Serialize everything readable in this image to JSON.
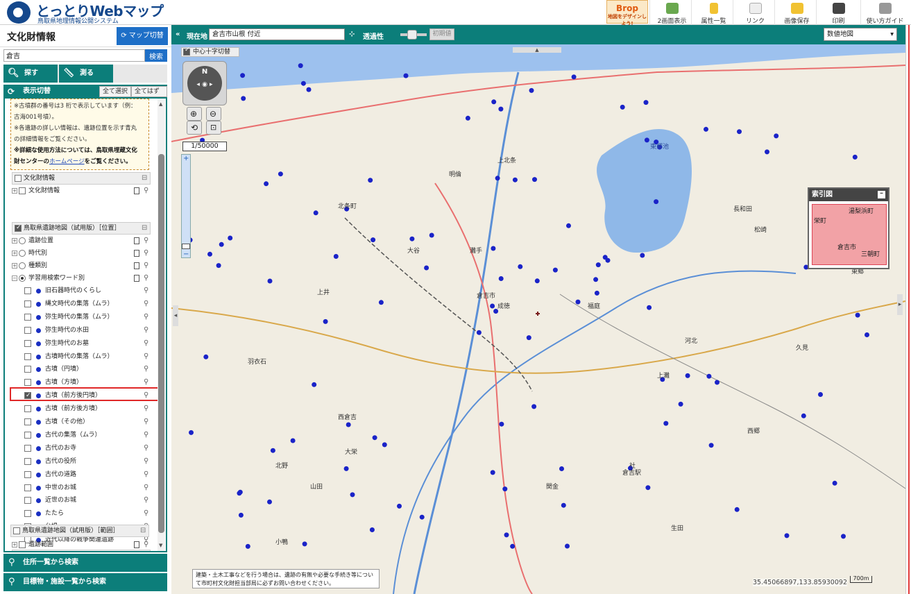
{
  "header": {
    "title": "とっとりWebマップ",
    "subtitle": "鳥取県地理情報公開システム",
    "ad_text": "地図をデザインしよう!",
    "ad_brand": "Brop",
    "toolbar": [
      {
        "label": "2画面表示",
        "icon": "split-screen-icon",
        "color": "#6aa84f"
      },
      {
        "label": "属性一覧",
        "icon": "attribute-list-icon",
        "color": "#f1c232"
      },
      {
        "label": "リンク",
        "icon": "mail-link-icon",
        "color": "#bbbbbb"
      },
      {
        "label": "画像保存",
        "icon": "image-save-icon",
        "color": "#f1c232"
      },
      {
        "label": "印刷",
        "icon": "print-icon",
        "color": "#444444"
      },
      {
        "label": "使い方ガイド",
        "icon": "guide-icon",
        "color": "#888888"
      }
    ]
  },
  "left_panel": {
    "title": "文化財情報",
    "map_switch": "マップ切替",
    "search_value": "倉吉",
    "search_button": "検索",
    "tabs": [
      {
        "label": "探す",
        "icon": "search-icon"
      },
      {
        "label": "測る",
        "icon": "ruler-icon"
      }
    ],
    "display_header": "表示切替",
    "select_all": "全て選択",
    "deselect_all": "全てはずす",
    "note_lines": [
      "※古墳群の番号は3 桁で表示しています（例：",
      "古海001号墳）。",
      "※各遺跡の詳しい情報は、遺跡位置を示す青丸",
      "の詳細情報をご覧ください。"
    ],
    "note_bold_1": "※詳細な使用方法については、鳥取県埋蔵文化",
    "note_bold_2_pre": "財センターの",
    "note_link": "ホームページ",
    "note_bold_2_post": "をご覧ください。",
    "groups": [
      {
        "label": "文化財情報",
        "checked": false
      },
      {
        "label": "鳥取県遺跡地図（試用版）［位置］",
        "checked": true
      },
      {
        "label": "鳥取県遺跡地図（試用版）［範囲］",
        "checked": false
      }
    ],
    "layers_top": [
      {
        "label": "文化財情報",
        "type": "checkbox"
      },
      {
        "label": "遺跡位置",
        "type": "radio"
      },
      {
        "label": "時代別",
        "type": "radio"
      },
      {
        "label": "種類別",
        "type": "radio"
      },
      {
        "label": "学習用検索ワード別",
        "type": "radio",
        "on": true
      }
    ],
    "sub_items": [
      {
        "label": "旧石器時代のくらし",
        "checked": false
      },
      {
        "label": "縄文時代の集落（ムラ）",
        "checked": false
      },
      {
        "label": "弥生時代の集落（ムラ）",
        "checked": false
      },
      {
        "label": "弥生時代の水田",
        "checked": false
      },
      {
        "label": "弥生時代のお墓",
        "checked": false
      },
      {
        "label": "古墳時代の集落（ムラ）",
        "checked": false
      },
      {
        "label": "古墳（円墳）",
        "checked": false
      },
      {
        "label": "古墳（方墳）",
        "checked": false
      },
      {
        "label": "古墳（前方後円墳）",
        "checked": true
      },
      {
        "label": "古墳（前方後方墳）",
        "checked": false
      },
      {
        "label": "古墳（その他）",
        "checked": false
      },
      {
        "label": "古代の集落（ムラ）",
        "checked": false
      },
      {
        "label": "古代のお寺",
        "checked": false
      },
      {
        "label": "古代の役所",
        "checked": false
      },
      {
        "label": "古代の道路",
        "checked": false
      },
      {
        "label": "中世のお城",
        "checked": false
      },
      {
        "label": "近世のお城",
        "checked": false
      },
      {
        "label": "たたら",
        "checked": false
      },
      {
        "label": "台場",
        "checked": false
      },
      {
        "label": "近代以降の戦争関連遺跡",
        "checked": false
      }
    ],
    "range_layer": "遺跡範囲",
    "bottom_links": [
      {
        "label": "住所一覧から検索",
        "icon": "search-icon"
      },
      {
        "label": "目標物・施設一覧から検索",
        "icon": "search-icon"
      }
    ]
  },
  "map_bar": {
    "location_label": "現在地",
    "location_value": "倉吉市山根 付近",
    "transparency_label": "透過性",
    "reset_button": "初期値",
    "basemap": "数値地図",
    "crosshair": "中心十字切替",
    "scale": "1/50000"
  },
  "index_map": {
    "title": "索引図",
    "labels": [
      "湯梨浜町",
      "倉吉市",
      "三朝町",
      "栄町"
    ]
  },
  "map": {
    "coordinate": "35.45066897,133.85930092",
    "scale_bar": "700m",
    "notice": "建築・土木工事などを行う場合は、遺跡の有無や必要な手続き等について市町村文化財担当部局に必ずお問い合わせください。",
    "lake_label": "東郷池",
    "place_labels": [
      "倉吉市",
      "北条町",
      "上井",
      "上北条",
      "西倉吉",
      "小鴨",
      "明倫",
      "河北",
      "東郷",
      "長和田",
      "松崎",
      "久見",
      "羽衣石",
      "関金",
      "西郷",
      "灘手",
      "社",
      "上灘",
      "成徳",
      "倉吉駅",
      "山田",
      "大栄",
      "北野",
      "福庭",
      "生田",
      "大谷"
    ],
    "site_color": "#1a23c8",
    "water_color": "#8fb8e8",
    "sea_color": "#9dc1ee"
  }
}
